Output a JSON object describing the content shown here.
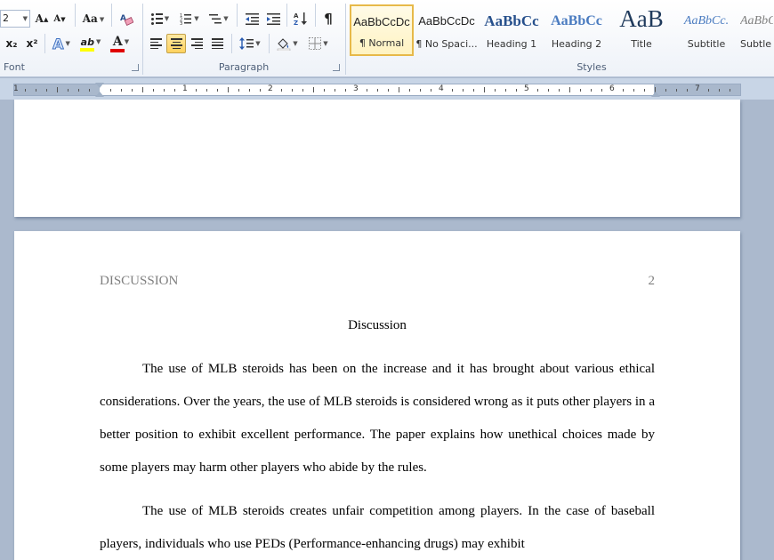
{
  "ribbon": {
    "font": {
      "label": "Font",
      "size_value": "2",
      "grow": "A",
      "shrink": "A",
      "change_case": "Aa",
      "subscript": "x₂",
      "superscript": "x²",
      "text_effects": "A",
      "highlight": "ab",
      "font_color": "A",
      "highlight_color": "#ffff00",
      "font_color_bar": "#e00000"
    },
    "paragraph": {
      "label": "Paragraph",
      "pilcrow": "¶"
    },
    "styles": {
      "label": "Styles",
      "items": [
        {
          "preview": "AaBbCcDc",
          "name": "¶ Normal"
        },
        {
          "preview": "AaBbCcDc",
          "name": "¶ No Spaci..."
        },
        {
          "preview": "AaBbCc",
          "name": "Heading 1"
        },
        {
          "preview": "AaBbCc",
          "name": "Heading 2"
        },
        {
          "preview": "AaB",
          "name": "Title"
        },
        {
          "preview": "AaBbCc.",
          "name": "Subtitle"
        },
        {
          "preview": "AaBbCc",
          "name": "Subtle E"
        }
      ]
    }
  },
  "ruler": {
    "numbers": [
      "1",
      "1",
      "2",
      "3",
      "4",
      "5",
      "6",
      "7"
    ]
  },
  "document": {
    "running_head": "DISCUSSION",
    "page_number": "2",
    "title": "Discussion",
    "paragraphs": [
      "The use of MLB steroids has been on the increase and it has brought about various ethical considerations. Over the years, the use of MLB steroids is considered wrong as it puts other players in a better position to exhibit excellent performance. The paper explains how unethical choices made by some players may harm other players who abide by the rules.",
      "The use of MLB steroids creates unfair competition among players. In the case of baseball players, individuals who use PEDs (Performance-enhancing drugs) may exhibit"
    ]
  }
}
